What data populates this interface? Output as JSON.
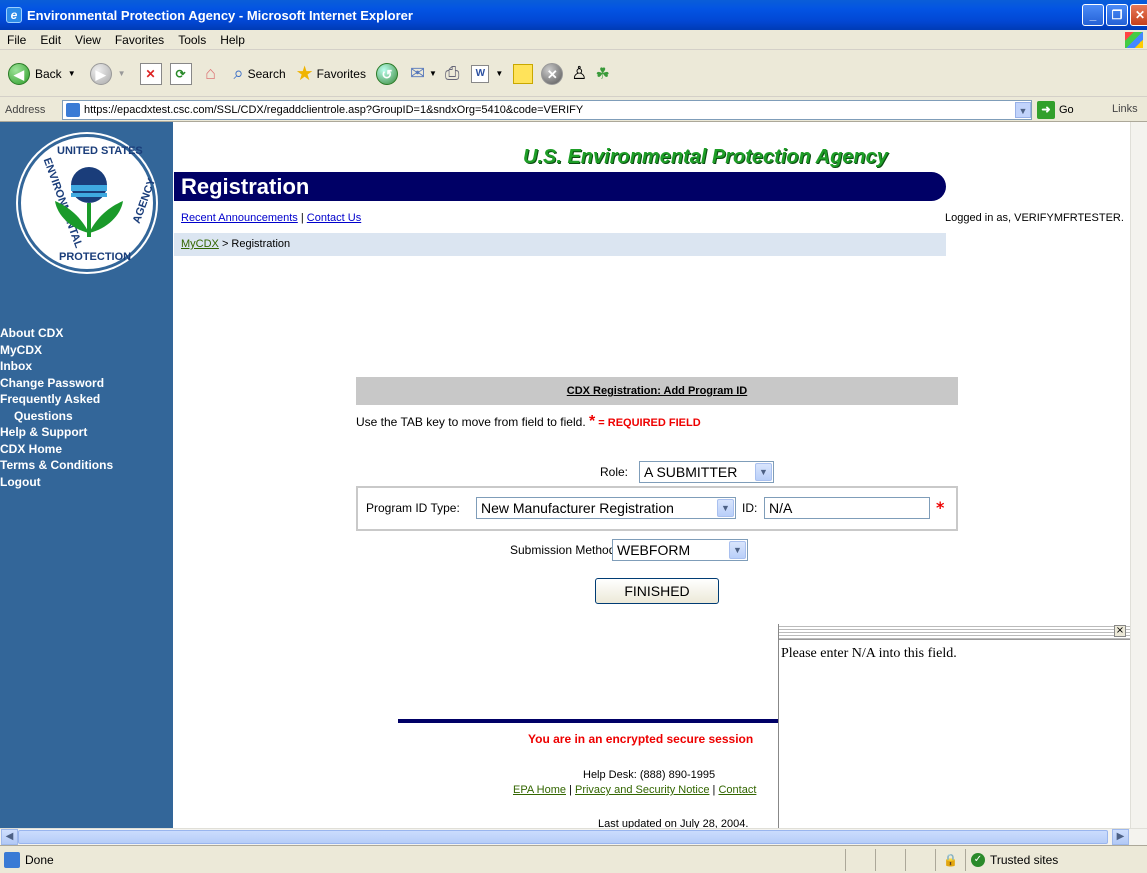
{
  "window": {
    "title": "Environmental Protection Agency - Microsoft Internet Explorer"
  },
  "menu": {
    "items": [
      "File",
      "Edit",
      "View",
      "Favorites",
      "Tools",
      "Help"
    ]
  },
  "toolbar": {
    "back_label": "Back",
    "search_label": "Search",
    "favorites_label": "Favorites"
  },
  "addressbar": {
    "label": "Address",
    "url": "https://epacdxtest.csc.com/SSL/CDX/regaddclientrole.asp?GroupID=1&sndxOrg=5410&code=VERIFY",
    "go_label": "Go",
    "links_label": "Links"
  },
  "sidebar": {
    "seal_top": "UNITED STATES",
    "seal_left": "ENVIRONMENTAL",
    "seal_right": "AGENCY",
    "seal_bottom": "PROTECTION",
    "nav": [
      {
        "label": "About CDX"
      },
      {
        "label": "MyCDX"
      },
      {
        "label": "Inbox"
      },
      {
        "label": "Change Password"
      },
      {
        "label": "Frequently Asked"
      },
      {
        "label": "Questions"
      },
      {
        "label": "Help & Support"
      },
      {
        "label": "CDX Home"
      },
      {
        "label": "Terms & Conditions"
      },
      {
        "label": "Logout"
      }
    ]
  },
  "header": {
    "agency": "U.S. Environmental Protection Agency",
    "section": "Registration",
    "recent_announcements": "Recent Announcements",
    "separator": " | ",
    "contact_us": "Contact Us",
    "logged_in": "Logged in as, VERIFYMFRTESTER.",
    "crumb_home": "MyCDX",
    "crumb_rest": " > Registration"
  },
  "form": {
    "heading": "CDX Registration: Add Program ID",
    "instructions": "Use the TAB key to move from field to field.",
    "required_marker": "*",
    "required_text": " = REQUIRED FIELD",
    "role_label": "Role:",
    "role_value": "A SUBMITTER",
    "program_type_label": "Program ID Type:",
    "program_type_value": "New Manufacturer Registration",
    "id_label": "ID:",
    "id_value": "N/A",
    "submission_label": "Submission Method:",
    "submission_value": "WEBFORM",
    "finished_label": "FINISHED"
  },
  "footer": {
    "secure_text": "You are in an encrypted secure session",
    "helpdesk": "Help Desk: (888) 890-1995",
    "epa_home": "EPA Home",
    "privacy": "Privacy and Security Notice",
    "contact": "Contact",
    "updated": "Last updated on July 28, 2004."
  },
  "popup": {
    "message": "Please enter N/A into this field.",
    "close_glyph": "×"
  },
  "statusbar": {
    "status": "Done",
    "zone": "Trusted sites"
  }
}
